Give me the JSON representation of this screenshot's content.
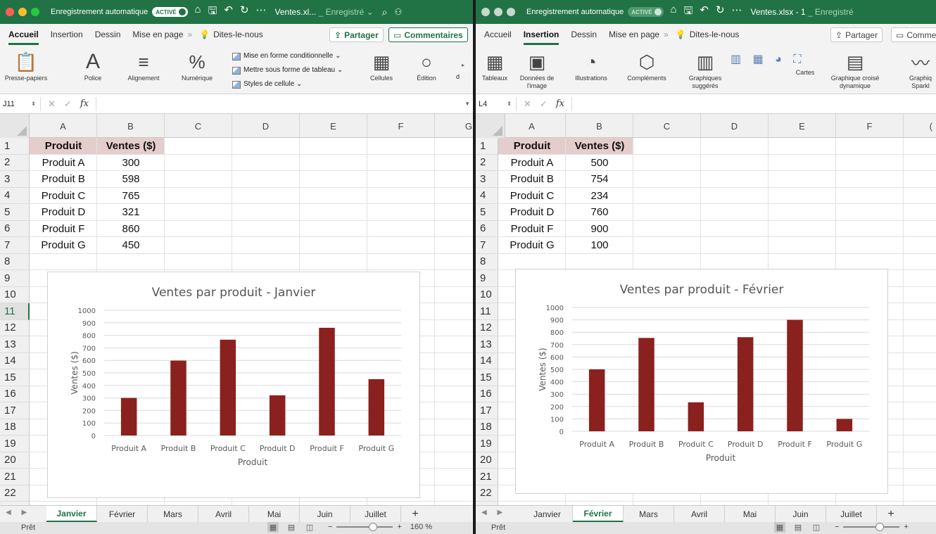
{
  "app": {
    "autosave_label": "Enregistrement automatique",
    "autosave_state": "ACTIVÉ",
    "accent": "#217346",
    "bar_color": "#8b211e",
    "header_fill": "#e5cdcd"
  },
  "left": {
    "filename": "Ventes.xl...",
    "filename_status": "_ Enregistré ⌄",
    "tabs": [
      "Accueil",
      "Insertion",
      "Dessin",
      "Mise en page"
    ],
    "active_tab": "Accueil",
    "tell_me": "Dites-le-nous",
    "share_label": "Partager",
    "comments_label": "Commentaires",
    "ribbon": {
      "clipboard": "Presse-papiers",
      "font": "Police",
      "alignment": "Alignement",
      "number": "Numérique",
      "cond_format": "Mise en forme conditionnelle ⌄",
      "format_table": "Mettre sous forme de tableau ⌄",
      "cell_styles": "Styles de cellule ⌄",
      "cells": "Cellules",
      "editing": "Édition",
      "cut_letter": "d"
    },
    "namebox": "J11",
    "columns": [
      "A",
      "B",
      "C",
      "D",
      "E",
      "F",
      "G"
    ],
    "rows": [
      "1",
      "2",
      "3",
      "4",
      "5",
      "6",
      "7",
      "8",
      "9",
      "10",
      "11",
      "12",
      "13",
      "14",
      "15",
      "16",
      "17",
      "18",
      "19",
      "20",
      "21",
      "22"
    ],
    "selected_row": "11",
    "table": {
      "headers": [
        "Produit",
        "Ventes ($)"
      ],
      "rows": [
        [
          "Produit A",
          "300"
        ],
        [
          "Produit B",
          "598"
        ],
        [
          "Produit C",
          "765"
        ],
        [
          "Produit D",
          "321"
        ],
        [
          "Produit F",
          "860"
        ],
        [
          "Produit G",
          "450"
        ]
      ]
    },
    "sheets": [
      "Janvier",
      "Février",
      "Mars",
      "Avril",
      "Mai",
      "Juin",
      "Juillet"
    ],
    "active_sheet": "Janvier",
    "status": "Prêt",
    "zoom": "160 %"
  },
  "right": {
    "filename": "Ventes.xlsx - 1",
    "filename_status": "_ Enregistré",
    "tabs": [
      "Accueil",
      "Insertion",
      "Dessin",
      "Mise en page"
    ],
    "active_tab": "Insertion",
    "tell_me": "Dites-le-nous",
    "share_label": "Partager",
    "comments_label": "Comme",
    "ribbon": {
      "tables": "Tableaux",
      "image_data": "Données de l'image",
      "illustrations": "Illustrations",
      "addins": "Compléments",
      "suggested_charts": "Graphiques suggérés",
      "maps": "Cartes",
      "pivot_chart": "Graphique croisé dynamique",
      "sparklines": "Graphiq Sparkl"
    },
    "namebox": "L4",
    "columns": [
      "A",
      "B",
      "C",
      "D",
      "E",
      "F",
      "("
    ],
    "rows": [
      "1",
      "2",
      "3",
      "4",
      "5",
      "6",
      "7",
      "8",
      "9",
      "10",
      "11",
      "12",
      "13",
      "14",
      "15",
      "16",
      "17",
      "18",
      "19",
      "20",
      "21",
      "22"
    ],
    "table": {
      "headers": [
        "Produit",
        "Ventes ($)"
      ],
      "rows": [
        [
          "Produit A",
          "500"
        ],
        [
          "Produit B",
          "754"
        ],
        [
          "Produit C",
          "234"
        ],
        [
          "Produit D",
          "760"
        ],
        [
          "Produit F",
          "900"
        ],
        [
          "Produit G",
          "100"
        ]
      ]
    },
    "sheets": [
      "Janvier",
      "Février",
      "Mars",
      "Avril",
      "Mai",
      "Juin",
      "Juillet"
    ],
    "active_sheet": "Février",
    "status": "Prêt"
  },
  "chart_data": [
    {
      "type": "bar",
      "title": "Ventes par produit - Janvier",
      "xlabel": "Produit",
      "ylabel": "Ventes ($)",
      "categories": [
        "Produit A",
        "Produit B",
        "Produit C",
        "Produit D",
        "Produit F",
        "Produit G"
      ],
      "values": [
        300,
        598,
        765,
        321,
        860,
        450
      ],
      "ylim": [
        0,
        1000
      ],
      "yticks": [
        0,
        100,
        200,
        300,
        400,
        500,
        600,
        700,
        800,
        900,
        1000
      ],
      "grid": true,
      "legend": "none",
      "color": "#8b211e"
    },
    {
      "type": "bar",
      "title": "Ventes par produit - Février",
      "xlabel": "Produit",
      "ylabel": "Ventes ($)",
      "categories": [
        "Produit A",
        "Produit B",
        "Produit C",
        "Produit D",
        "Produit F",
        "Produit G"
      ],
      "values": [
        500,
        754,
        234,
        760,
        900,
        100
      ],
      "ylim": [
        0,
        1000
      ],
      "yticks": [
        0,
        100,
        200,
        300,
        400,
        500,
        600,
        700,
        800,
        900,
        1000
      ],
      "grid": true,
      "legend": "none",
      "color": "#8b211e"
    }
  ]
}
